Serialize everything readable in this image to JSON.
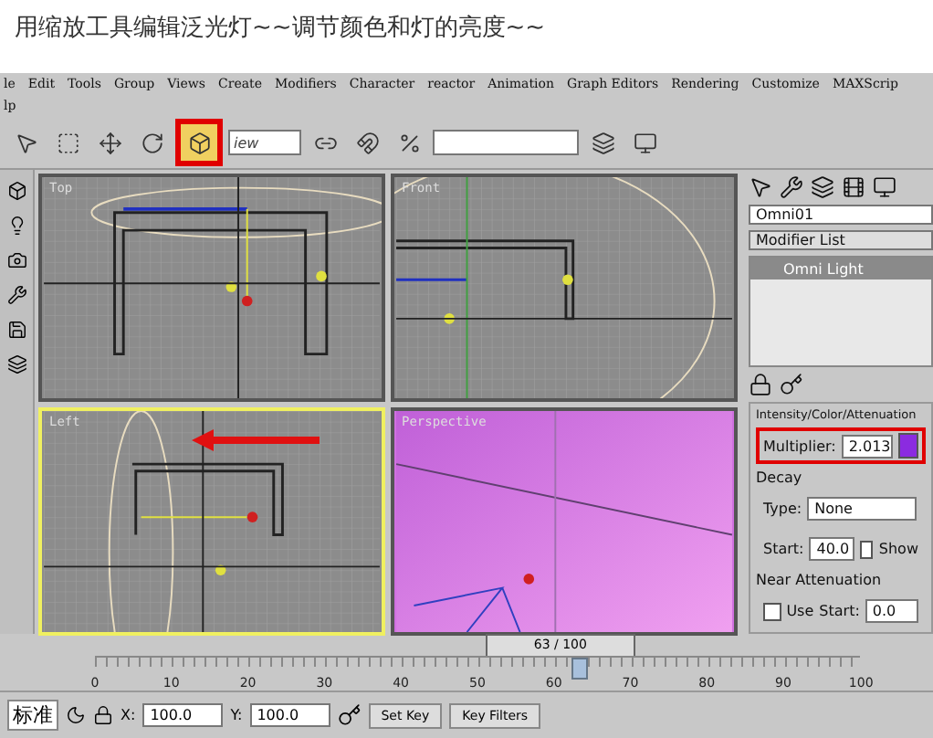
{
  "caption": "用缩放工具编辑泛光灯~~调节颜色和灯的亮度~~",
  "menu": [
    "le",
    "Edit",
    "Tools",
    "Group",
    "Views",
    "Create",
    "Modifiers",
    "Character",
    "reactor",
    "Animation",
    "Graph Editors",
    "Rendering",
    "Customize",
    "MAXScrip"
  ],
  "menu_row2": "lp",
  "toolbar": {
    "view_dropdown": "iew",
    "scale_highlighted": true
  },
  "viewports": [
    {
      "label": "Top",
      "kind": "top",
      "selected": false,
      "arrow": false
    },
    {
      "label": "Front",
      "kind": "front",
      "selected": false,
      "arrow": false
    },
    {
      "label": "Left",
      "kind": "left",
      "selected": true,
      "arrow": true
    },
    {
      "label": "Perspective",
      "kind": "perspective",
      "selected": false,
      "arrow": false
    }
  ],
  "command_panel": {
    "object_name": "Omni01",
    "modifier_list": "Modifier List",
    "stack": [
      {
        "label": "Omni Light",
        "selected": true
      }
    ],
    "rollout": "Intensity/Color/Attenuation",
    "multiplier": {
      "label": "Multiplier:",
      "value": "2.013",
      "color": "#8b2be0",
      "highlighted": true
    },
    "decay": {
      "title": "Decay",
      "type_label": "Type:",
      "type_value": "None",
      "start_label": "Start:",
      "start_value": "40.0",
      "show": {
        "label": "Show",
        "checked": false
      }
    },
    "near_attenuation": {
      "title": "Near Attenuation",
      "use": {
        "label": "Use",
        "checked": false
      },
      "start_label": "Start:",
      "start_value": "0.0"
    }
  },
  "timeline": {
    "frame": "63 / 100",
    "level": 0.63,
    "ticks": [
      "0",
      "10",
      "20",
      "30",
      "40",
      "50",
      "60",
      "70",
      "80",
      "90",
      "100"
    ]
  },
  "status_bar": {
    "mode": "标准",
    "x_label": "X:",
    "x_value": "100.0",
    "y_label": "Y:",
    "y_value": "100.0",
    "set_key": "Set Key",
    "key_filters": "Key Filters"
  }
}
